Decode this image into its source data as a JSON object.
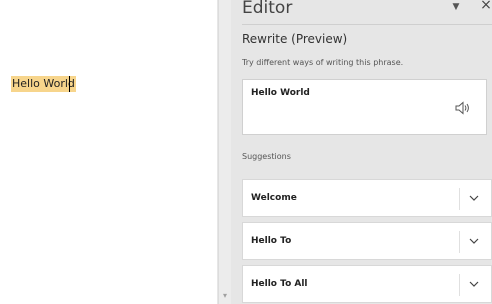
{
  "document": {
    "selected_text": "Hello World"
  },
  "editor_pane": {
    "title": "Editor",
    "options_icon": "chevron-down-icon",
    "close_label": "×",
    "section_heading": "Rewrite (Preview)",
    "section_description": "Try different ways of writing this phrase.",
    "current_phrase": "Hello World",
    "speaker_icon": "speaker-icon",
    "suggestions_label": "Suggestions",
    "suggestions": [
      {
        "label": "Welcome"
      },
      {
        "label": "Hello To"
      },
      {
        "label": "Hello To All"
      }
    ]
  },
  "colors": {
    "highlight": "#f7d58c",
    "pane_background": "#e6e6e6",
    "card_background": "#ffffff"
  }
}
